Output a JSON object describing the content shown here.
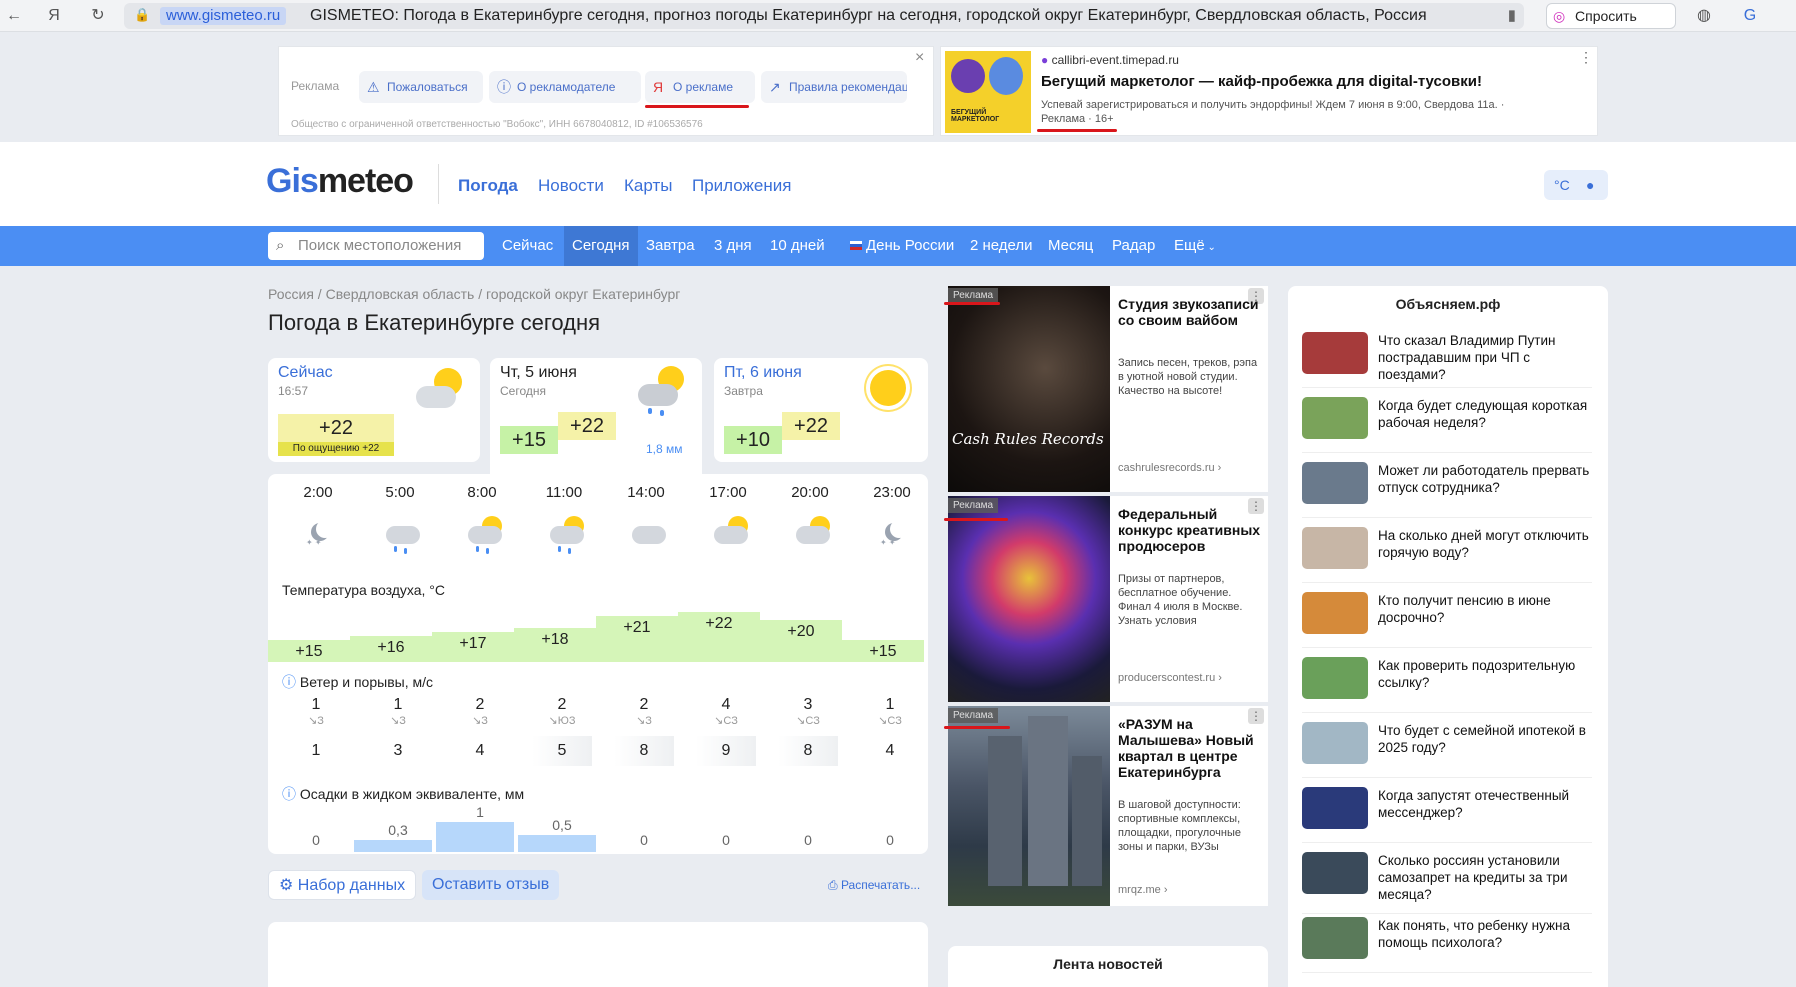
{
  "browser": {
    "domain": "www.gismeteo.ru",
    "title": "GISMETEO: Погода в Екатеринбурге сегодня, прогноз погоды Екатеринбург на сегодня, городской округ Екатеринбург, Свердловская область, Россия",
    "ask_label": "Спросить"
  },
  "top_ad": {
    "label": "Реклама",
    "chips": [
      "Пожаловаться",
      "О рекламодателе",
      "О рекламе",
      "Правила рекомендаций"
    ],
    "legal": "Общество с ограниченной ответственностью \"Вобокс\", ИНН 6678040812, ID #106536576",
    "source": "callibri-event.timepad.ru",
    "headline": "Бегущий маркетолог — кайф-пробежка для digital-тусовки!",
    "text": "Успевай зарегистрироваться и получить эндорфины! Ждем 7 июня в 9:00, Свердова 11а. ·",
    "footer": "Реклама · 16+",
    "img_caption": "БЕГУЩИЙ МАРКЕТОЛОГ"
  },
  "header": {
    "logo_a": "Gis",
    "logo_b": "meteo",
    "nav": [
      "Погода",
      "Новости",
      "Карты",
      "Приложения"
    ],
    "unit": "°C"
  },
  "bluenav": {
    "search_placeholder": "Поиск местоположения",
    "tabs": [
      "Сейчас",
      "Сегодня",
      "Завтра",
      "3 дня",
      "10 дней",
      "День России",
      "2 недели",
      "Месяц",
      "Радар",
      "Ещё"
    ]
  },
  "breadcrumb": "Россия / Свердловская область / городской округ Екатеринбург",
  "page_title": "Погода в Екатеринбурге сегодня",
  "now_card": {
    "label": "Сейчас",
    "time": "16:57",
    "temp": "+22",
    "feels": "По ощущению +22"
  },
  "today_card": {
    "label": "Чт, 5 июня",
    "sub": "Сегодня",
    "min": "+15",
    "max": "+22",
    "precip": "1,8 мм"
  },
  "tomorrow_card": {
    "label": "Пт, 6 июня",
    "sub": "Завтра",
    "min": "+10",
    "max": "+22"
  },
  "hours": [
    "2:00",
    "5:00",
    "8:00",
    "11:00",
    "14:00",
    "17:00",
    "20:00",
    "23:00"
  ],
  "temp_label": "Температура воздуха, °C",
  "temps": [
    "+15",
    "+16",
    "+17",
    "+18",
    "+21",
    "+22",
    "+20",
    "+15"
  ],
  "wind_label": "Ветер и порывы, м/с",
  "wind_speed": [
    "1",
    "1",
    "2",
    "2",
    "2",
    "4",
    "3",
    "1"
  ],
  "wind_dir": [
    "З",
    "З",
    "З",
    "ЮЗ",
    "З",
    "СЗ",
    "СЗ",
    "СЗ"
  ],
  "gusts": [
    "1",
    "3",
    "4",
    "5",
    "8",
    "9",
    "8",
    "4"
  ],
  "precip_label": "Осадки в жидком эквиваленте, мм",
  "precip": [
    "0",
    "0,3",
    "1",
    "0,5",
    "0",
    "0",
    "0",
    "0"
  ],
  "buttons": {
    "dataset": "Набор данных",
    "feedback": "Оставить отзыв",
    "print": "Распечатать..."
  },
  "ads": [
    {
      "badge": "Реклама",
      "title": "Студия звукозаписи со своим вайбом",
      "desc": "Запись песен, треков, рэпа в уютной новой студии. Качество на высоте!",
      "url": "cashrulesrecords.ru",
      "img_text": "Cash Rules Records"
    },
    {
      "badge": "Реклама",
      "title": "Федеральный конкурс креативных продюсеров",
      "desc": "Призы от партнеров, бесплатное обучение. Финал 4 июля в Москве. Узнать условия",
      "url": "producerscontest.ru"
    },
    {
      "badge": "Реклама",
      "title": "«РАЗУМ на Малышева» Новый квартал в центре Екатеринбурга",
      "desc": "В шаговой доступности: спортивные комплексы, площадки, прогулочные зоны и парки, ВУЗы",
      "url": "mrqz.me"
    }
  ],
  "news_feed_title": "Лента новостей",
  "right": {
    "title": "Объясняем.рф",
    "items": [
      "Что сказал Владимир Путин пострадавшим при ЧП с поездами?",
      "Когда будет следующая короткая рабочая неделя?",
      "Может ли работодатель прервать отпуск сотрудника?",
      "На сколько дней могут отключить горячую воду?",
      "Кто получит пенсию в июне досрочно?",
      "Как проверить подозрительную ссылку?",
      "Что будет с семейной ипотекой в 2025 году?",
      "Когда запустят отечественный мессенджер?",
      "Сколько россиян установили самозапрет на кредиты за три месяца?",
      "Как понять, что ребенку нужна помощь психолога?"
    ]
  }
}
